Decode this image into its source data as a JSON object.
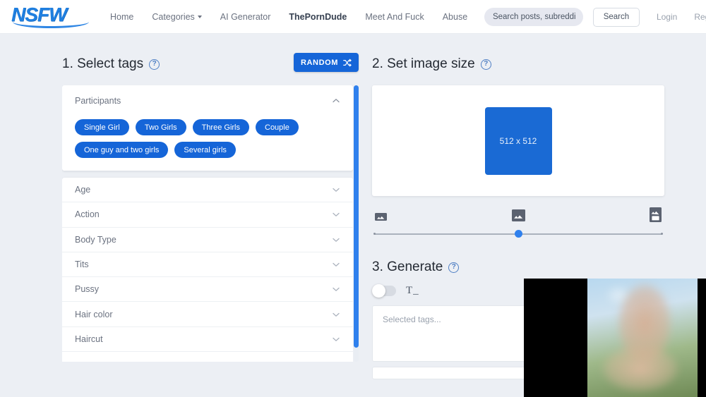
{
  "navbar": {
    "logo_text": "NSFW",
    "links": [
      {
        "label": "Home",
        "active": false,
        "caret": false
      },
      {
        "label": "Categories",
        "active": false,
        "caret": true
      },
      {
        "label": "AI Generator",
        "active": false,
        "caret": false
      },
      {
        "label": "ThePornDude",
        "active": true,
        "caret": false
      },
      {
        "label": "Meet And Fuck",
        "active": false,
        "caret": false
      },
      {
        "label": "Abuse",
        "active": false,
        "caret": false
      }
    ],
    "search_placeholder": "Search posts, subreddi",
    "search_value": "",
    "search_button": "Search",
    "login_label": "Login",
    "register_label": "Regis"
  },
  "step1": {
    "title": "1. Select tags",
    "help": "?",
    "random_button": "RANDOM",
    "participants": {
      "label": "Participants",
      "expanded": true,
      "chips": [
        "Single Girl",
        "Two Girls",
        "Three Girls",
        "Couple",
        "One guy and two girls",
        "Several girls"
      ]
    },
    "accordion": [
      "Age",
      "Action",
      "Body Type",
      "Tits",
      "Pussy",
      "Hair color",
      "Haircut"
    ]
  },
  "step2": {
    "title": "2. Set image size",
    "help": "?",
    "selected_size": "512 x 512",
    "slider_position_percent": 50
  },
  "step3": {
    "title": "3. Generate",
    "help": "?",
    "toggle_on": false,
    "text_mode_icon": "T_",
    "tags_placeholder": "Selected tags...",
    "tags_value": ""
  },
  "colors": {
    "accent": "#1565d8",
    "scrollbar": "#2f80ed",
    "page_bg": "#eceff4",
    "nav_bg": "#ffffff"
  }
}
